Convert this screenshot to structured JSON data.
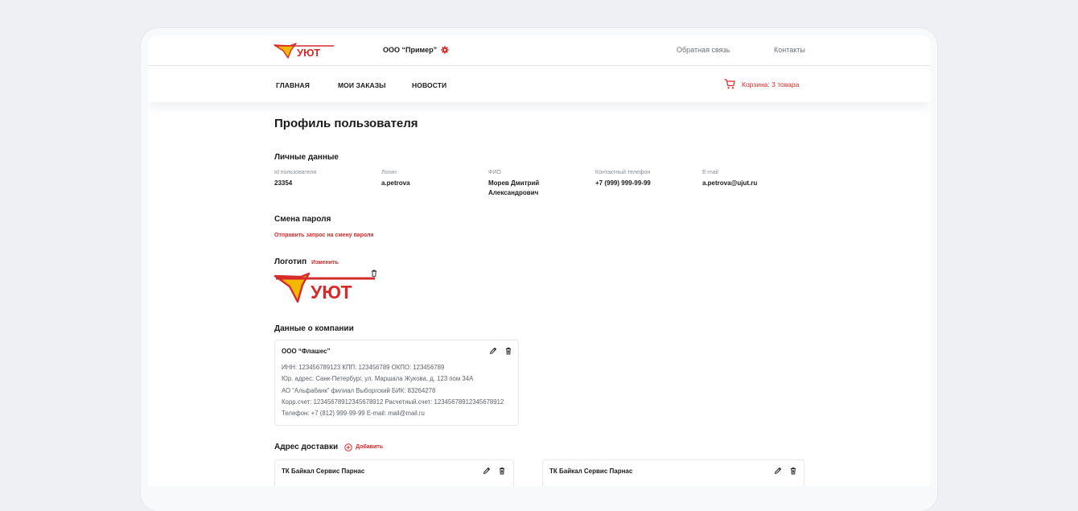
{
  "header": {
    "company_name": "ООО “Пример”",
    "links": [
      "Обратная связь",
      "Контакты"
    ]
  },
  "nav": {
    "items": [
      "ГЛАВНАЯ",
      "МОИ ЗАКАЗЫ",
      "НОВОСТИ"
    ],
    "cart_label": "Корзина: 3 товара"
  },
  "page_title": "Профиль пользователя",
  "personal": {
    "heading": "Личные данные",
    "fields": [
      {
        "label": "Id пользователя",
        "value": "23354"
      },
      {
        "label": "Логин",
        "value": "a.petrova"
      },
      {
        "label": "ФИО",
        "value": "Морев Дмитрий Александрович"
      },
      {
        "label": "Контактный телефон",
        "value": "+7 (999) 999-99-99"
      },
      {
        "label": "E-mail",
        "value": "a.petrova@ujut.ru"
      }
    ]
  },
  "password": {
    "heading": "Смена пароля",
    "link": "Отправить запрос на смену пароля"
  },
  "logo_section": {
    "heading": "Логотип",
    "change_link": "Изменить",
    "logo_text": "УЮТ"
  },
  "company": {
    "heading": "Данные о компании",
    "card": {
      "name": "ООО “Флашес”",
      "lines": [
        "ИНН: 123456789123    КПП: 123456789    ОКПО: 123456789",
        "Юр. адрес: Санк-Петербург, ул. Маршала Жукова, д. 123 пом 34А",
        "АО “Альфабанк” филиал Выборгский    БИК: 83264278",
        "Корр.счет: 12345678912345678912    Расчетный.счет: 12345678912345678912",
        "Телефон: +7 (812) 999-99-99    E-mail: mail@mail.ru"
      ]
    }
  },
  "delivery": {
    "heading": "Адрес доставки",
    "add_label": "Добавить",
    "cards": [
      {
        "name": "ТК Байкал Сервис Парнас"
      },
      {
        "name": "ТК Байкал Сервис Парнас"
      }
    ]
  },
  "colors": {
    "accent": "#d62b2b",
    "logo_yellow": "#f5b800",
    "background": "#eef0f4"
  }
}
